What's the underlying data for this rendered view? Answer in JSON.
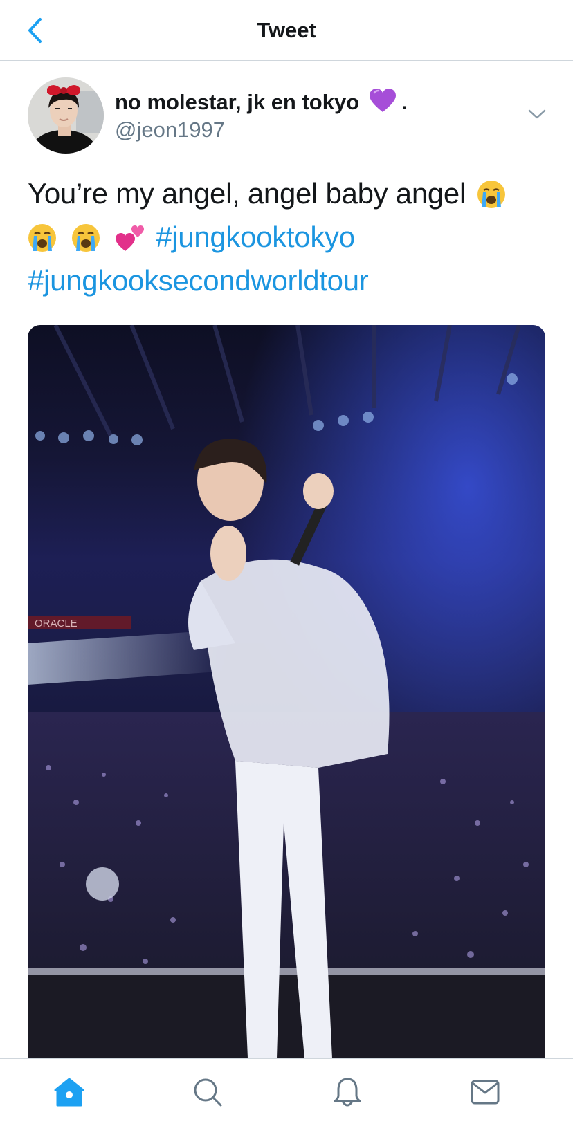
{
  "header": {
    "title": "Tweet",
    "back_icon": "chevron-left-icon"
  },
  "tweet": {
    "display_name": "no molestar, jk en tokyo",
    "display_name_suffix": ".",
    "handle": "@jeon1997",
    "text_line1": "You’re my angel, angel baby angel",
    "hashtag1": "#jungkooktokyo",
    "hashtag2": "#jungkooksecondworldtour",
    "emojis": [
      "loudly-crying-face",
      "loudly-crying-face",
      "loudly-crying-face",
      "two-hearts"
    ],
    "name_emoji": "purple-heart",
    "menu_icon": "chevron-down-icon",
    "media_text": "ORACLE"
  },
  "tabbar": {
    "items": [
      {
        "icon": "home-icon",
        "active": true
      },
      {
        "icon": "search-icon",
        "active": false
      },
      {
        "icon": "bell-icon",
        "active": false
      },
      {
        "icon": "mail-icon",
        "active": false
      }
    ]
  },
  "colors": {
    "accent": "#1da1f2",
    "hashtag": "#1b95e0",
    "text": "#14171a",
    "secondary": "#657786",
    "divider": "#cfd6dc"
  }
}
